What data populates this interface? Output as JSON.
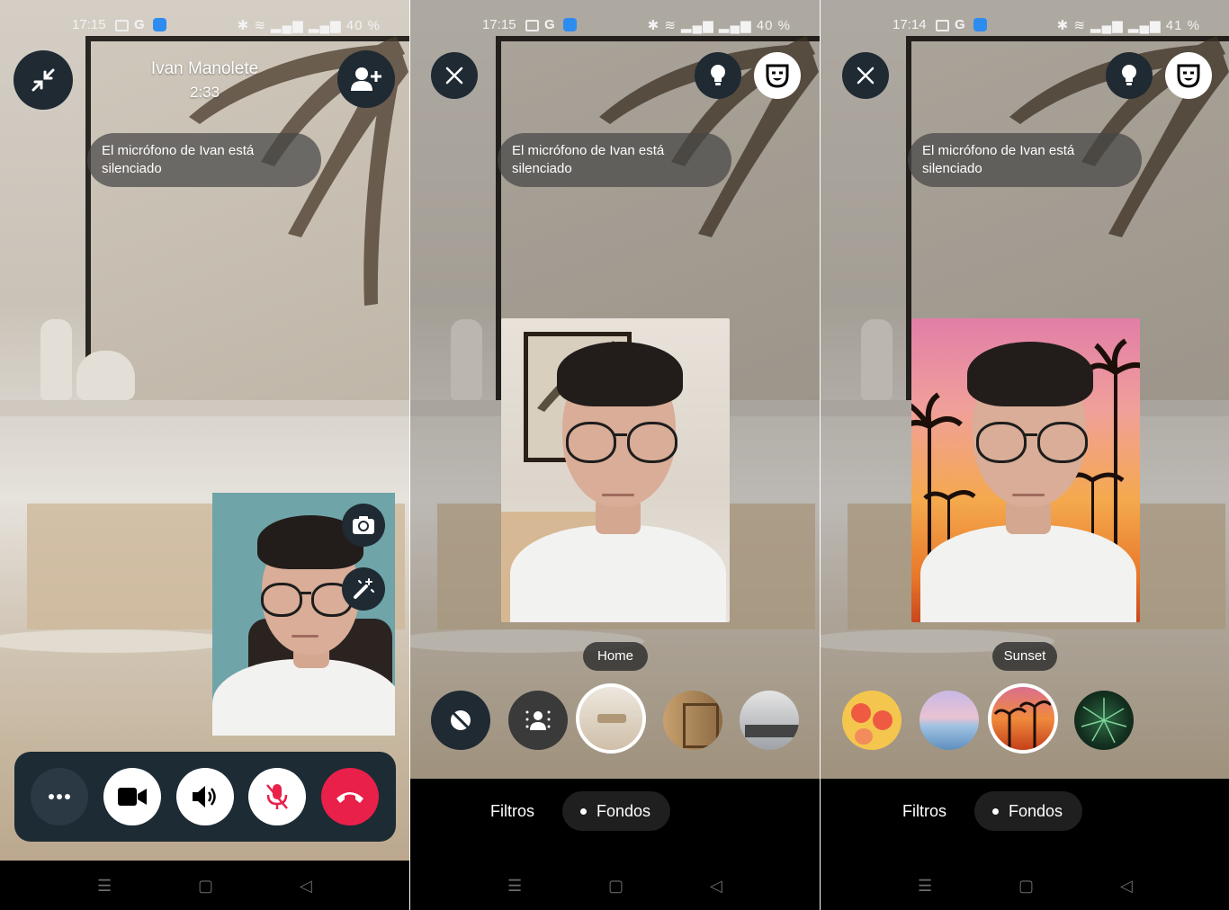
{
  "panels": [
    {
      "status": {
        "time": "17:15",
        "right": "40 %"
      },
      "call": {
        "name": "Ivan Manolete",
        "duration": "2:33"
      },
      "toast": "El micrófono de Ivan está silenciado",
      "controls": {
        "accent_end": "#e8204a"
      }
    },
    {
      "status": {
        "time": "17:15",
        "right": "40 %"
      },
      "toast": "El micrófono de Ivan está silenciado",
      "effect_label": "Home",
      "tabs": {
        "filters": "Filtros",
        "backgrounds": "Fondos"
      }
    },
    {
      "status": {
        "time": "17:14",
        "right": "41 %"
      },
      "toast": "El micrófono de Ivan está silenciado",
      "effect_label": "Sunset",
      "tabs": {
        "filters": "Filtros",
        "backgrounds": "Fondos"
      }
    }
  ],
  "nav": {
    "recents": "☰",
    "home": "▢",
    "back": "◁"
  }
}
